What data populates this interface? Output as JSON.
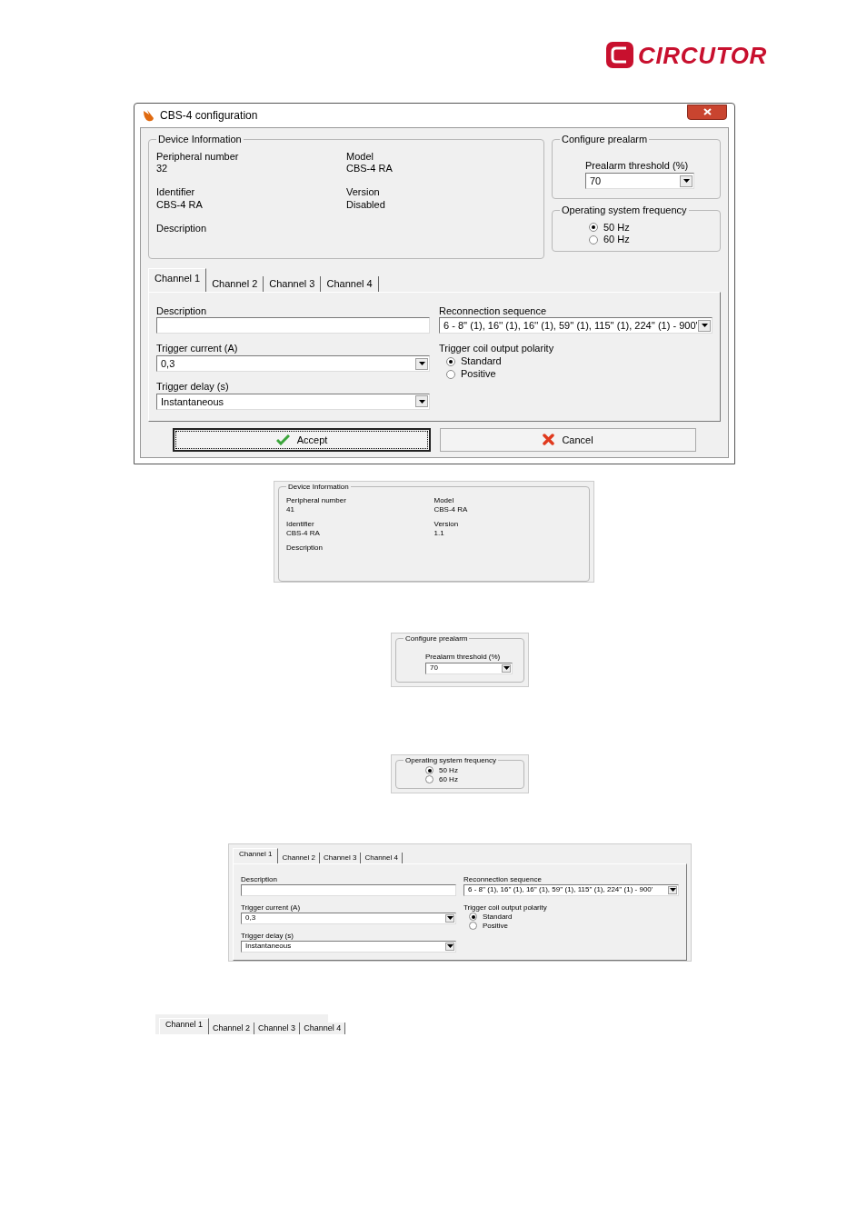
{
  "logo": {
    "text": "CIRCUTOR"
  },
  "dialog": {
    "title": "CBS-4 configuration",
    "device_info": {
      "title": "Device Information",
      "fields": [
        {
          "label": "Peripheral number",
          "value": "32"
        },
        {
          "label": "Model",
          "value": "CBS-4 RA"
        },
        {
          "label": "Identifier",
          "value": "CBS-4 RA"
        },
        {
          "label": "Version",
          "value": "Disabled"
        },
        {
          "label": "Description"
        }
      ]
    },
    "prealarm": {
      "title": "Configure prealarm",
      "label": "Prealarm threshold (%)",
      "value": "70"
    },
    "frequency": {
      "title": "Operating system frequency",
      "options": [
        {
          "label": "50 Hz",
          "selected": true
        },
        {
          "label": "60 Hz",
          "selected": false
        }
      ]
    },
    "channel": {
      "tabs": [
        {
          "label": "Channel 1",
          "selected": true
        },
        {
          "label": "Channel 2",
          "selected": false
        },
        {
          "label": "Channel 3",
          "selected": false
        },
        {
          "label": "Channel 4",
          "selected": false
        }
      ],
      "description_label": "Description",
      "reconnection": {
        "label": "Reconnection sequence",
        "value": "6 - 8'' (1), 16'' (1), 16'' (1), 59'' (1), 115'' (1), 224'' (1) - 900'"
      },
      "trigger_current": {
        "label": "Trigger current (A)",
        "value": "0,3"
      },
      "polarity": {
        "label": "Trigger coil output polarity",
        "options": [
          {
            "label": "Standard",
            "selected": true
          },
          {
            "label": "Positive",
            "selected": false
          }
        ]
      },
      "trigger_delay": {
        "label": "Trigger delay (s)",
        "value": "Instantaneous"
      }
    },
    "buttons": [
      {
        "label": "Accept",
        "kind": "accept",
        "focused": true
      },
      {
        "label": "Cancel",
        "kind": "cancel",
        "focused": false
      }
    ]
  },
  "device_info": {
    "title": "Device Information",
    "fields": [
      {
        "label": "Peripheral number",
        "value": "41"
      },
      {
        "label": "Model",
        "value": "CBS-4 RA"
      },
      {
        "label": "Identifier",
        "value": "CBS-4 RA"
      },
      {
        "label": "Version",
        "value": "1.1"
      },
      {
        "label": "Description"
      }
    ]
  },
  "prealarm": {
    "title": "Configure prealarm",
    "label": "Prealarm threshold (%)",
    "value": "70"
  },
  "frequency": {
    "title": "Operating system frequency",
    "options": [
      {
        "label": "50 Hz",
        "selected": true
      },
      {
        "label": "60 Hz",
        "selected": false
      }
    ]
  },
  "channel": {
    "tabs": [
      {
        "label": "Channel 1",
        "selected": true
      },
      {
        "label": "Channel 2",
        "selected": false
      },
      {
        "label": "Channel 3",
        "selected": false
      },
      {
        "label": "Channel 4",
        "selected": false
      }
    ],
    "description_label": "Description",
    "reconnection": {
      "label": "Reconnection sequence",
      "value": "6 - 8'' (1), 16'' (1), 16'' (1), 59'' (1), 115'' (1), 224'' (1) - 900'"
    },
    "trigger_current": {
      "label": "Trigger current (A)",
      "value": "0,3"
    },
    "polarity": {
      "label": "Trigger coil output polarity",
      "options": [
        {
          "label": "Standard",
          "selected": true
        },
        {
          "label": "Positive",
          "selected": false
        }
      ]
    },
    "trigger_delay": {
      "label": "Trigger delay (s)",
      "value": "Instantaneous"
    }
  },
  "tab_strip": {
    "tabs": [
      {
        "label": "Channel 1",
        "selected": true
      },
      {
        "label": "Channel 2",
        "selected": false
      },
      {
        "label": "Channel 3",
        "selected": false
      },
      {
        "label": "Channel 4",
        "selected": false
      }
    ]
  }
}
